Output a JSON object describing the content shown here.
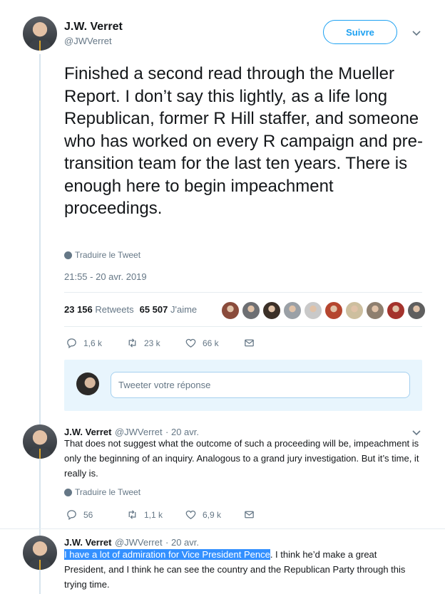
{
  "main_tweet": {
    "author_name": "J.W. Verret",
    "handle": "@JWVerret",
    "follow_label": "Suivre",
    "text": "Finished a second read through the Mueller Report.  I don’t say this lightly, as a life long Republican, former R Hill staffer, and someone who has worked on every R campaign and pre-transition team for the last ten years.  There is enough here to begin impeachment proceedings.",
    "translate_label": "Traduire le Tweet",
    "timestamp": "21:55 - 20 avr. 2019",
    "retweets_count": "23 156",
    "retweets_label": "Retweets",
    "likes_count": "65 507",
    "likes_label": "J'aime",
    "replies": "1,6 k",
    "retweets_short": "23 k",
    "likes_short": "66 k",
    "liker_colors": [
      "#8a4b3b",
      "#6d6f73",
      "#3b3028",
      "#9aa0a6",
      "#c9c9c9",
      "#b5462f",
      "#cdbf9f",
      "#8e7f6f",
      "#a4332c",
      "#5f5f5f"
    ]
  },
  "reply_box": {
    "placeholder": "Tweeter votre réponse"
  },
  "reply1": {
    "author_name": "J.W. Verret",
    "handle": "@JWVerret",
    "date": "· 20 avr.",
    "text": "That does not suggest what the outcome of such a proceeding will be, impeachment is only the beginning of an inquiry.  Analogous to a grand jury investigation.  But it’s time, it really is.",
    "translate_label": "Traduire le Tweet",
    "replies": "56",
    "retweets": "1,1 k",
    "likes": "6,9 k"
  },
  "reply2": {
    "author_name": "J.W. Verret",
    "handle": "@JWVerret",
    "date": "· 20 avr.",
    "text_highlighted": "I have a lot of admiration for Vice President Pence",
    "text_rest": ". I think he’d make a great President, and I think he can see the country and the Republican Party through this trying time."
  }
}
